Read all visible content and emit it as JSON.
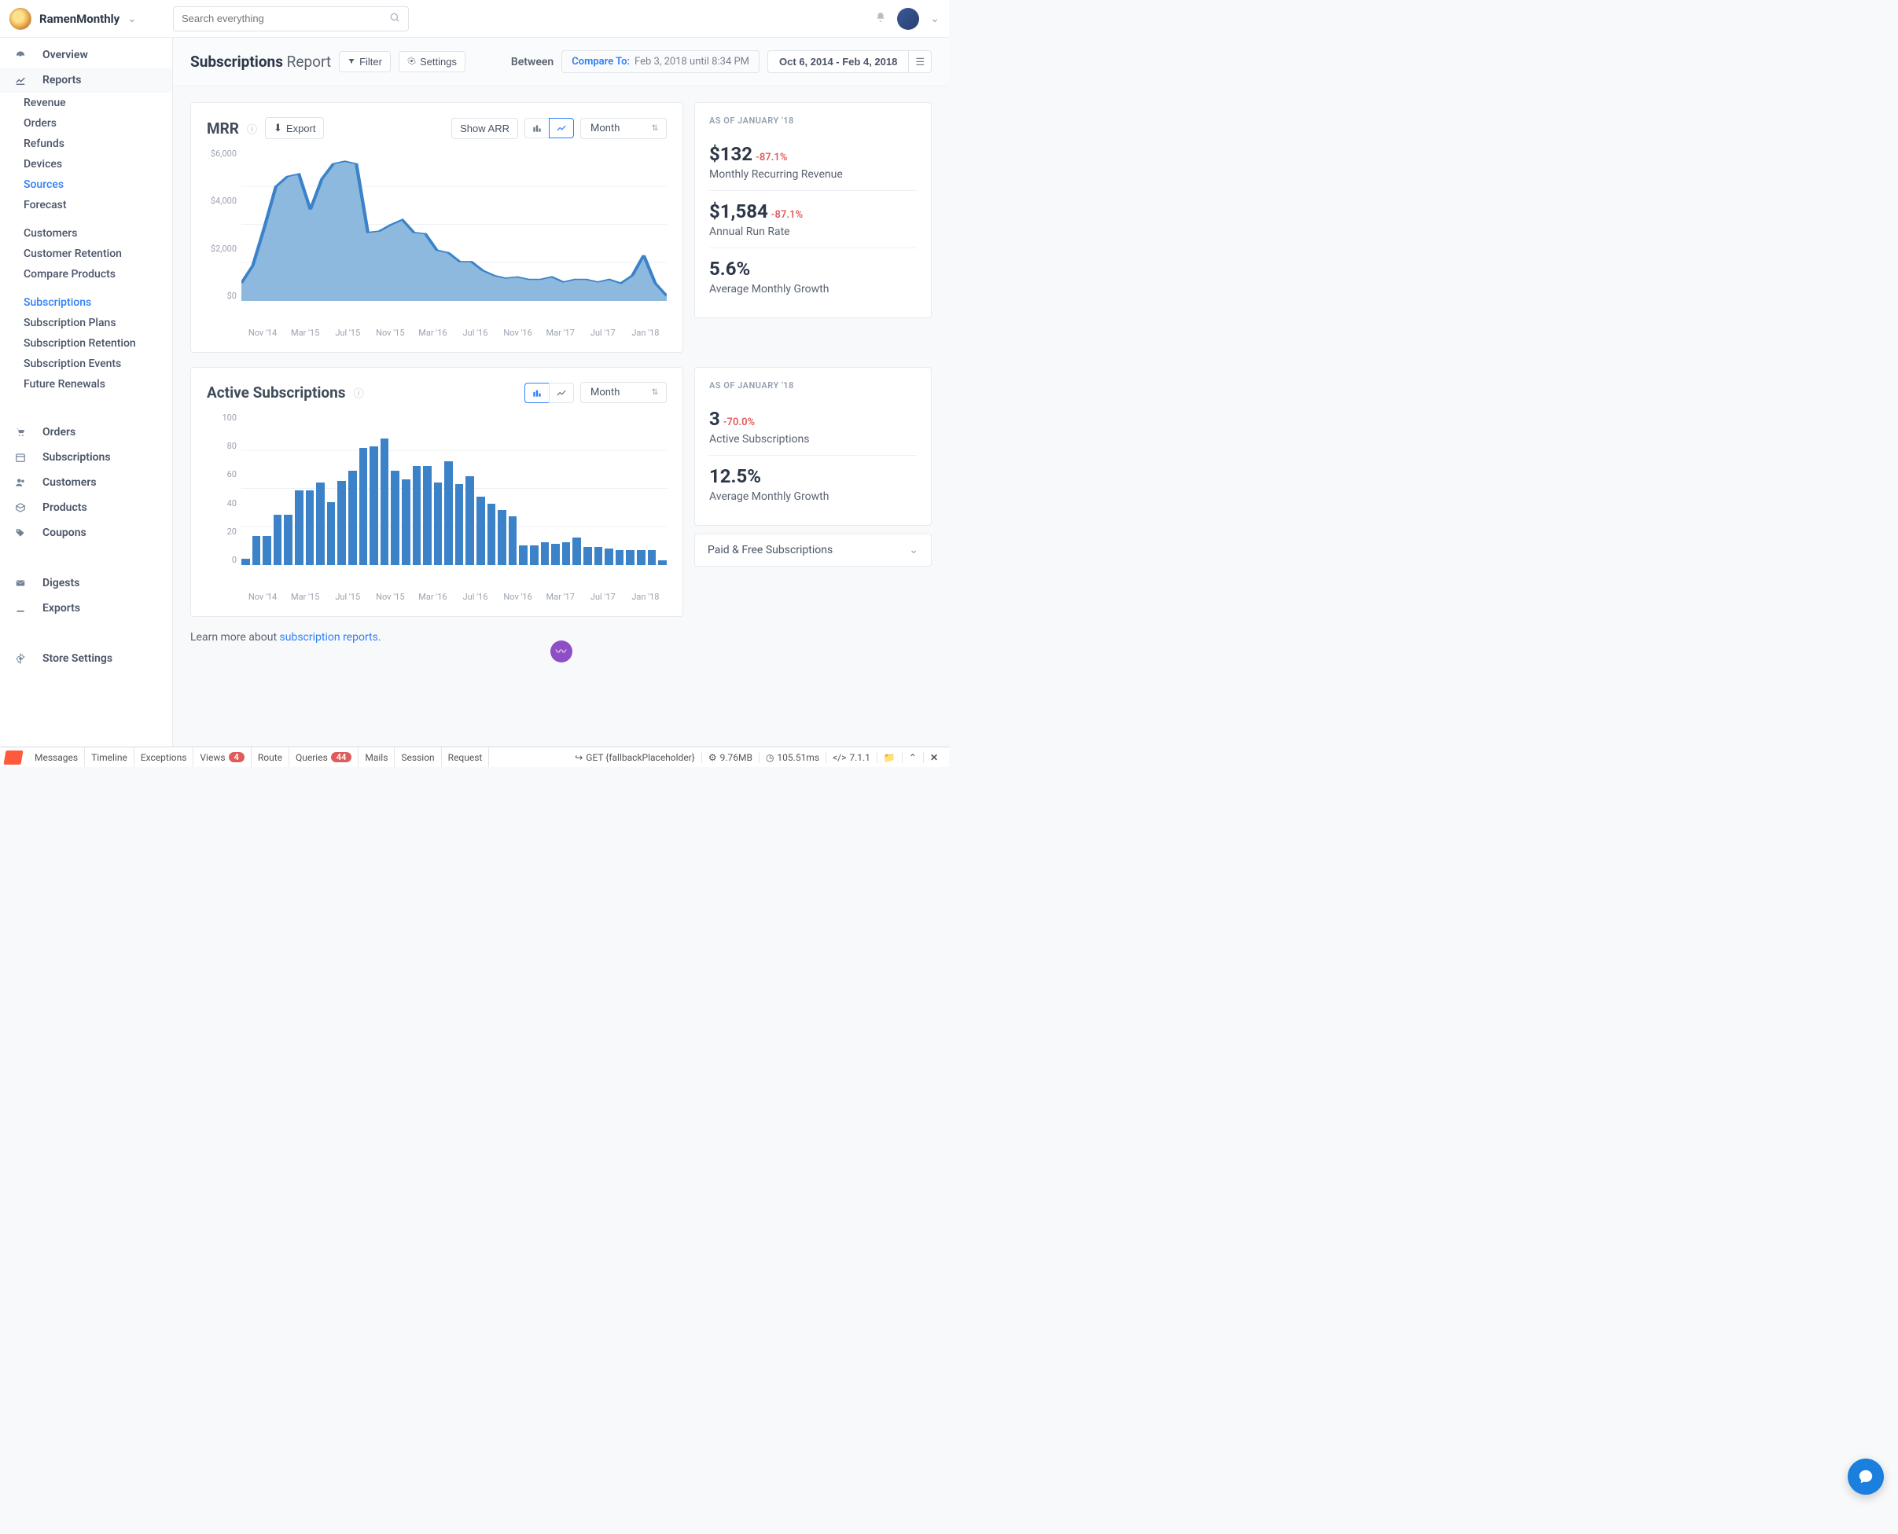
{
  "brand": {
    "name": "RamenMonthly"
  },
  "search": {
    "placeholder": "Search everything"
  },
  "sidebar": {
    "primary": [
      {
        "label": "Overview",
        "icon": "dashboard"
      },
      {
        "label": "Reports",
        "icon": "chart-line"
      }
    ],
    "reports": [
      {
        "label": "Revenue"
      },
      {
        "label": "Orders"
      },
      {
        "label": "Refunds"
      },
      {
        "label": "Devices"
      },
      {
        "label": "Sources",
        "active": true
      },
      {
        "label": "Forecast"
      }
    ],
    "reports2": [
      {
        "label": "Customers"
      },
      {
        "label": "Customer Retention"
      },
      {
        "label": "Compare Products"
      }
    ],
    "reports3": [
      {
        "label": "Subscriptions",
        "active": true
      },
      {
        "label": "Subscription Plans"
      },
      {
        "label": "Subscription Retention"
      },
      {
        "label": "Subscription Events"
      },
      {
        "label": "Future Renewals"
      }
    ],
    "secondary": [
      {
        "label": "Orders",
        "icon": "cart"
      },
      {
        "label": "Subscriptions",
        "icon": "calendar"
      },
      {
        "label": "Customers",
        "icon": "users"
      },
      {
        "label": "Products",
        "icon": "box"
      },
      {
        "label": "Coupons",
        "icon": "tag"
      }
    ],
    "tertiary": [
      {
        "label": "Digests",
        "icon": "envelope"
      },
      {
        "label": "Exports",
        "icon": "download"
      }
    ],
    "settings": {
      "label": "Store Settings",
      "icon": "gear"
    }
  },
  "header": {
    "title_bold": "Subscriptions",
    "title_regular": " Report",
    "filter_label": "Filter",
    "settings_label": "Settings",
    "between_label": "Between",
    "compare_prefix": "Compare To:",
    "compare_value": "Feb 3, 2018 until 8:34 PM",
    "date_range": "Oct 6, 2014 - Feb 4, 2018"
  },
  "section1": {
    "title": "MRR",
    "export_label": "Export",
    "show_arr_label": "Show ARR",
    "period": "Month",
    "kpi_caption": "AS OF JANUARY '18",
    "stats": [
      {
        "value": "$132",
        "delta": "-87.1%",
        "label": "Monthly Recurring Revenue"
      },
      {
        "value": "$1,584",
        "delta": "-87.1%",
        "label": "Annual Run Rate"
      },
      {
        "value": "5.6%",
        "delta": "",
        "label": "Average Monthly Growth"
      }
    ]
  },
  "section2": {
    "title": "Active Subscriptions",
    "period": "Month",
    "kpi_caption": "AS OF JANUARY '18",
    "stats": [
      {
        "value": "3",
        "delta": "-70.0%",
        "label": "Active Subscriptions"
      },
      {
        "value": "12.5%",
        "delta": "",
        "label": "Average Monthly Growth"
      }
    ],
    "collapse_label": "Paid & Free Subscriptions"
  },
  "chart_data": [
    {
      "type": "area",
      "title": "MRR",
      "x_labels": [
        "Nov '14",
        "Mar '15",
        "Jul '15",
        "Nov '15",
        "Mar '16",
        "Jul '16",
        "Nov '16",
        "Mar '17",
        "Jul '17",
        "Jan '18"
      ],
      "y_ticks": [
        "$6,000",
        "$4,000",
        "$2,000",
        "$0"
      ],
      "ylim": [
        0,
        6000
      ],
      "values": [
        700,
        1400,
        2900,
        4500,
        4900,
        5000,
        3600,
        4800,
        5400,
        5500,
        5400,
        2700,
        2750,
        3000,
        3200,
        2700,
        2650,
        2000,
        1900,
        1550,
        1550,
        1200,
        1000,
        900,
        950,
        850,
        850,
        950,
        750,
        850,
        850,
        750,
        850,
        700,
        1000,
        1800,
        700,
        200
      ]
    },
    {
      "type": "bar",
      "title": "Active Subscriptions",
      "x_labels": [
        "Nov '14",
        "Mar '15",
        "Jul '15",
        "Nov '15",
        "Mar '16",
        "Jul '16",
        "Nov '16",
        "Mar '17",
        "Jul '17",
        "Jan '18"
      ],
      "y_ticks": [
        "100",
        "80",
        "60",
        "40",
        "20",
        "0"
      ],
      "ylim": [
        0,
        100
      ],
      "values": [
        4,
        19,
        19,
        33,
        33,
        49,
        49,
        54,
        41,
        55,
        62,
        77,
        78,
        83,
        62,
        56,
        65,
        65,
        54,
        68,
        53,
        58,
        45,
        40,
        36,
        32,
        13,
        13,
        15,
        14,
        15,
        18,
        12,
        12,
        11,
        10,
        10,
        10,
        10,
        3
      ]
    }
  ],
  "learn_more": {
    "prefix": "Learn more about ",
    "link": "subscription reports"
  },
  "debugbar": {
    "items": [
      "Messages",
      "Timeline",
      "Exceptions",
      "Views",
      "Route",
      "Queries",
      "Mails",
      "Session",
      "Request"
    ],
    "views_badge": "4",
    "queries_badge": "44",
    "route_text": "GET {fallbackPlaceholder}",
    "memory": "9.76MB",
    "time": "105.51ms",
    "version": "7.1.1"
  }
}
